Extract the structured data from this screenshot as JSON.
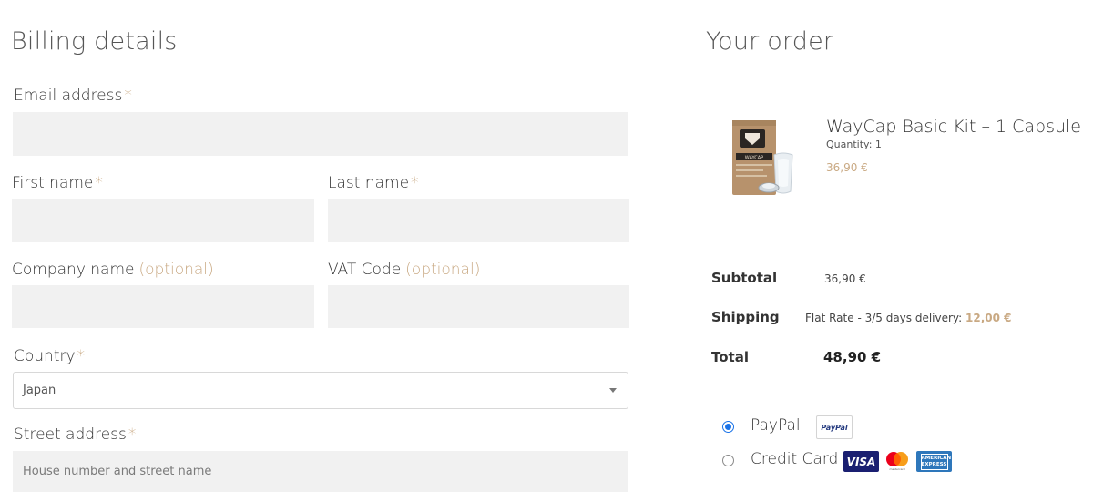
{
  "billing": {
    "title": "Billing details",
    "required_mark": "*",
    "email": {
      "label": "Email address",
      "value": ""
    },
    "first_name": {
      "label": "First name",
      "value": ""
    },
    "last_name": {
      "label": "Last name",
      "value": ""
    },
    "company": {
      "label": "Company name",
      "optional": "(optional)",
      "value": ""
    },
    "vat": {
      "label": "VAT Code",
      "optional": "(optional)",
      "value": ""
    },
    "country": {
      "label": "Country",
      "selected": "Japan"
    },
    "street": {
      "label": "Street address",
      "placeholder": "House number and street name"
    }
  },
  "order": {
    "title": "Your order",
    "product": {
      "name": "WayCap Basic Kit – 1 Capsule",
      "quantity": "Quantity: 1",
      "price": "36,90 €",
      "image_text": "WAYCAP"
    },
    "subtotal": {
      "label": "Subtotal",
      "value": "36,90 €"
    },
    "shipping": {
      "label": "Shipping",
      "value": "Flat Rate - 3/5 days delivery:",
      "amount": "12,00 €"
    },
    "total": {
      "label": "Total",
      "value": "48,90 €"
    }
  },
  "payment": {
    "methods": [
      {
        "label": "PayPal",
        "selected": true,
        "badge": "PayPal"
      },
      {
        "label": "Credit Card",
        "selected": false,
        "badges": [
          "VISA",
          "mastercard",
          "AMERICAN EXPRESS"
        ]
      }
    ]
  },
  "colors": {
    "accent": "#c9a983",
    "field_bg": "#f1f1f1",
    "radio_selected": "#1a73e8"
  }
}
